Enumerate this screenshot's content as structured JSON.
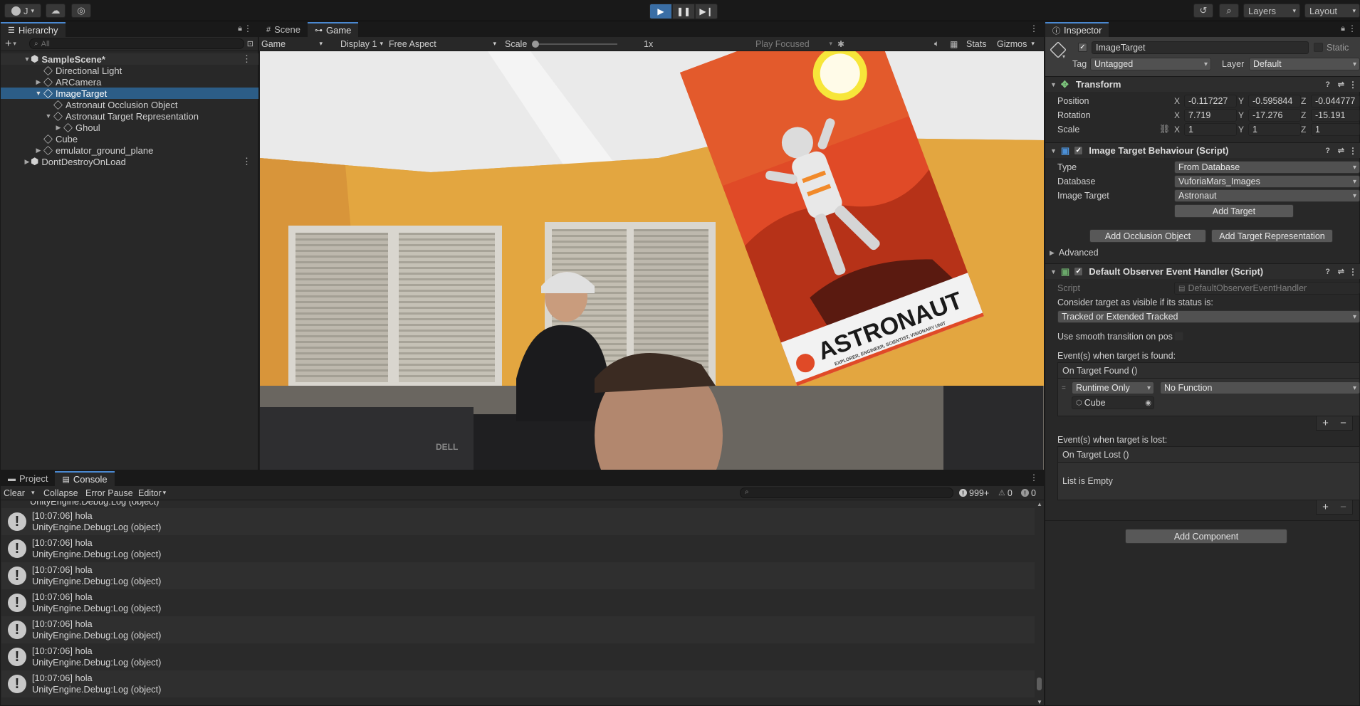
{
  "toolbar": {
    "account_label": "J",
    "layers_label": "Layers",
    "layout_label": "Layout"
  },
  "hierarchy": {
    "tab_label": "Hierarchy",
    "search_placeholder": "All",
    "items": [
      {
        "label": "SampleScene*"
      },
      {
        "label": "Directional Light"
      },
      {
        "label": "ARCamera"
      },
      {
        "label": "ImageTarget"
      },
      {
        "label": "Astronaut Occlusion Object"
      },
      {
        "label": "Astronaut Target Representation"
      },
      {
        "label": "Ghoul"
      },
      {
        "label": "Cube"
      },
      {
        "label": "emulator_ground_plane"
      },
      {
        "label": "DontDestroyOnLoad"
      }
    ]
  },
  "game": {
    "tabs": [
      {
        "label": "Scene"
      },
      {
        "label": "Game"
      }
    ],
    "mode_label": "Game",
    "display_label": "Display 1",
    "aspect_label": "Free Aspect",
    "scale_label": "Scale",
    "scale_value": "1x",
    "play_focused_label": "Play Focused",
    "stats_label": "Stats",
    "gizmos_label": "Gizmos",
    "poster": {
      "title": "ASTRONAUT",
      "subtitle": "EXPLORER, ENGINEER, SCIENTIST, VISIONARY UNIT"
    },
    "monitor_brand": "DELL"
  },
  "inspector": {
    "tab_label": "Inspector",
    "object_name": "ImageTarget",
    "static_label": "Static",
    "tag_label": "Tag",
    "tag_value": "Untagged",
    "layer_label": "Layer",
    "layer_value": "Default",
    "transform": {
      "title": "Transform",
      "position_label": "Position",
      "rotation_label": "Rotation",
      "scale_label": "Scale",
      "axis_x": "X",
      "axis_y": "Y",
      "axis_z": "Z",
      "position": {
        "x": "-0.117227",
        "y": "-0.595844",
        "z": "-0.044777"
      },
      "rotation": {
        "x": "7.719",
        "y": "-17.276",
        "z": "-15.191"
      },
      "scale": {
        "x": "1",
        "y": "1",
        "z": "1"
      }
    },
    "image_target": {
      "title": "Image Target Behaviour (Script)",
      "type_label": "Type",
      "type_value": "From Database",
      "database_label": "Database",
      "database_value": "VuforiaMars_Images",
      "image_target_label": "Image Target",
      "image_target_value": "Astronaut",
      "add_target_button": "Add Target",
      "add_occlusion_button": "Add Occlusion Object",
      "add_representation_button": "Add Target Representation",
      "advanced_label": "Advanced"
    },
    "observer": {
      "title": "Default Observer Event Handler (Script)",
      "script_label": "Script",
      "script_value": "DefaultObserverEventHandler",
      "consider_label": "Consider target as visible if its status is:",
      "status_value": "Tracked or Extended Tracked",
      "smooth_label": "Use smooth transition on pos",
      "found_label": "Event(s) when target is found:",
      "found_event": "On Target Found ()",
      "runtime_value": "Runtime Only",
      "function_value": "No Function",
      "object_value": "Cube",
      "lost_label": "Event(s) when target is lost:",
      "lost_event": "On Target Lost ()",
      "empty_label": "List is Empty"
    },
    "add_component_button": "Add Component"
  },
  "console": {
    "tabs": [
      {
        "label": "Project"
      },
      {
        "label": "Console"
      }
    ],
    "clear_label": "Clear",
    "collapse_label": "Collapse",
    "error_pause_label": "Error Pause",
    "editor_label": "Editor",
    "log_count": "999+",
    "warn_count": "0",
    "error_count": "0",
    "partial_line": "UnityEngine.Debug:Log (object)",
    "entries": [
      {
        "line1": "[10:07:06] hola",
        "line2": "UnityEngine.Debug:Log (object)"
      },
      {
        "line1": "[10:07:06] hola",
        "line2": "UnityEngine.Debug:Log (object)"
      },
      {
        "line1": "[10:07:06] hola",
        "line2": "UnityEngine.Debug:Log (object)"
      },
      {
        "line1": "[10:07:06] hola",
        "line2": "UnityEngine.Debug:Log (object)"
      },
      {
        "line1": "[10:07:06] hola",
        "line2": "UnityEngine.Debug:Log (object)"
      },
      {
        "line1": "[10:07:06] hola",
        "line2": "UnityEngine.Debug:Log (object)"
      },
      {
        "line1": "[10:07:06] hola",
        "line2": "UnityEngine.Debug:Log (object)"
      }
    ]
  },
  "colors": {
    "selection": "#2c5d87",
    "play_active": "#3a6ea5",
    "wall": "#e3a640",
    "poster": "#e04a27"
  }
}
